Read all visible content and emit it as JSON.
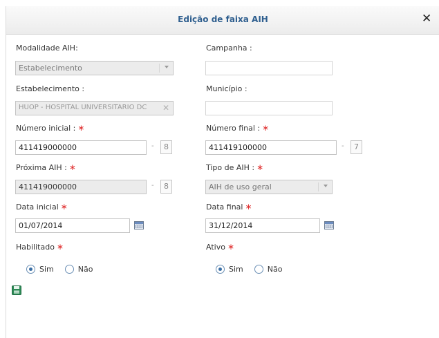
{
  "dialog": {
    "title": "Edição de faixa AIH",
    "close_symbol": "✕"
  },
  "form": {
    "modalidade": {
      "label": "Modalidade AIH:",
      "value": "Estabelecimento"
    },
    "campanha": {
      "label": "Campanha :",
      "value": ""
    },
    "estabelecimento": {
      "label": "Estabelecimento :",
      "value": "HUOP - HOSPITAL UNIVERSITARIO DC",
      "clear_symbol": "✕"
    },
    "municipio": {
      "label": "Município :",
      "value": ""
    },
    "numero_inicial": {
      "label": "Número inicial :",
      "required": "∗",
      "value": "411419000000",
      "dv": "8"
    },
    "numero_final": {
      "label": "Número final :",
      "required": "∗",
      "value": "411419100000",
      "dv": "7"
    },
    "proxima_aih": {
      "label": "Próxima AIH :",
      "required": "∗",
      "value": "411419000000",
      "dv": "8"
    },
    "tipo_aih": {
      "label": "Tipo de AIH :",
      "required": "∗",
      "value": "AIH de uso geral"
    },
    "data_inicial": {
      "label": "Data inicial",
      "required": "∗",
      "value": "01/07/2014"
    },
    "data_final": {
      "label": "Data final",
      "required": "∗",
      "value": "31/12/2014"
    },
    "habilitado": {
      "label": "Habilitado",
      "required": "∗",
      "options": [
        "Sim",
        "Não"
      ],
      "selected": "Sim"
    },
    "ativo": {
      "label": "Ativo",
      "required": "∗",
      "options": [
        "Sim",
        "Não"
      ],
      "selected": "Sim"
    },
    "dash": "-"
  },
  "icons": {
    "close": "close-icon",
    "dropdown": "chevron-down-icon",
    "calendar": "calendar-icon",
    "save": "save-icon"
  },
  "colors": {
    "title": "#2f5f8f",
    "required": "#e03030",
    "save_icon": "#2e8b57"
  }
}
